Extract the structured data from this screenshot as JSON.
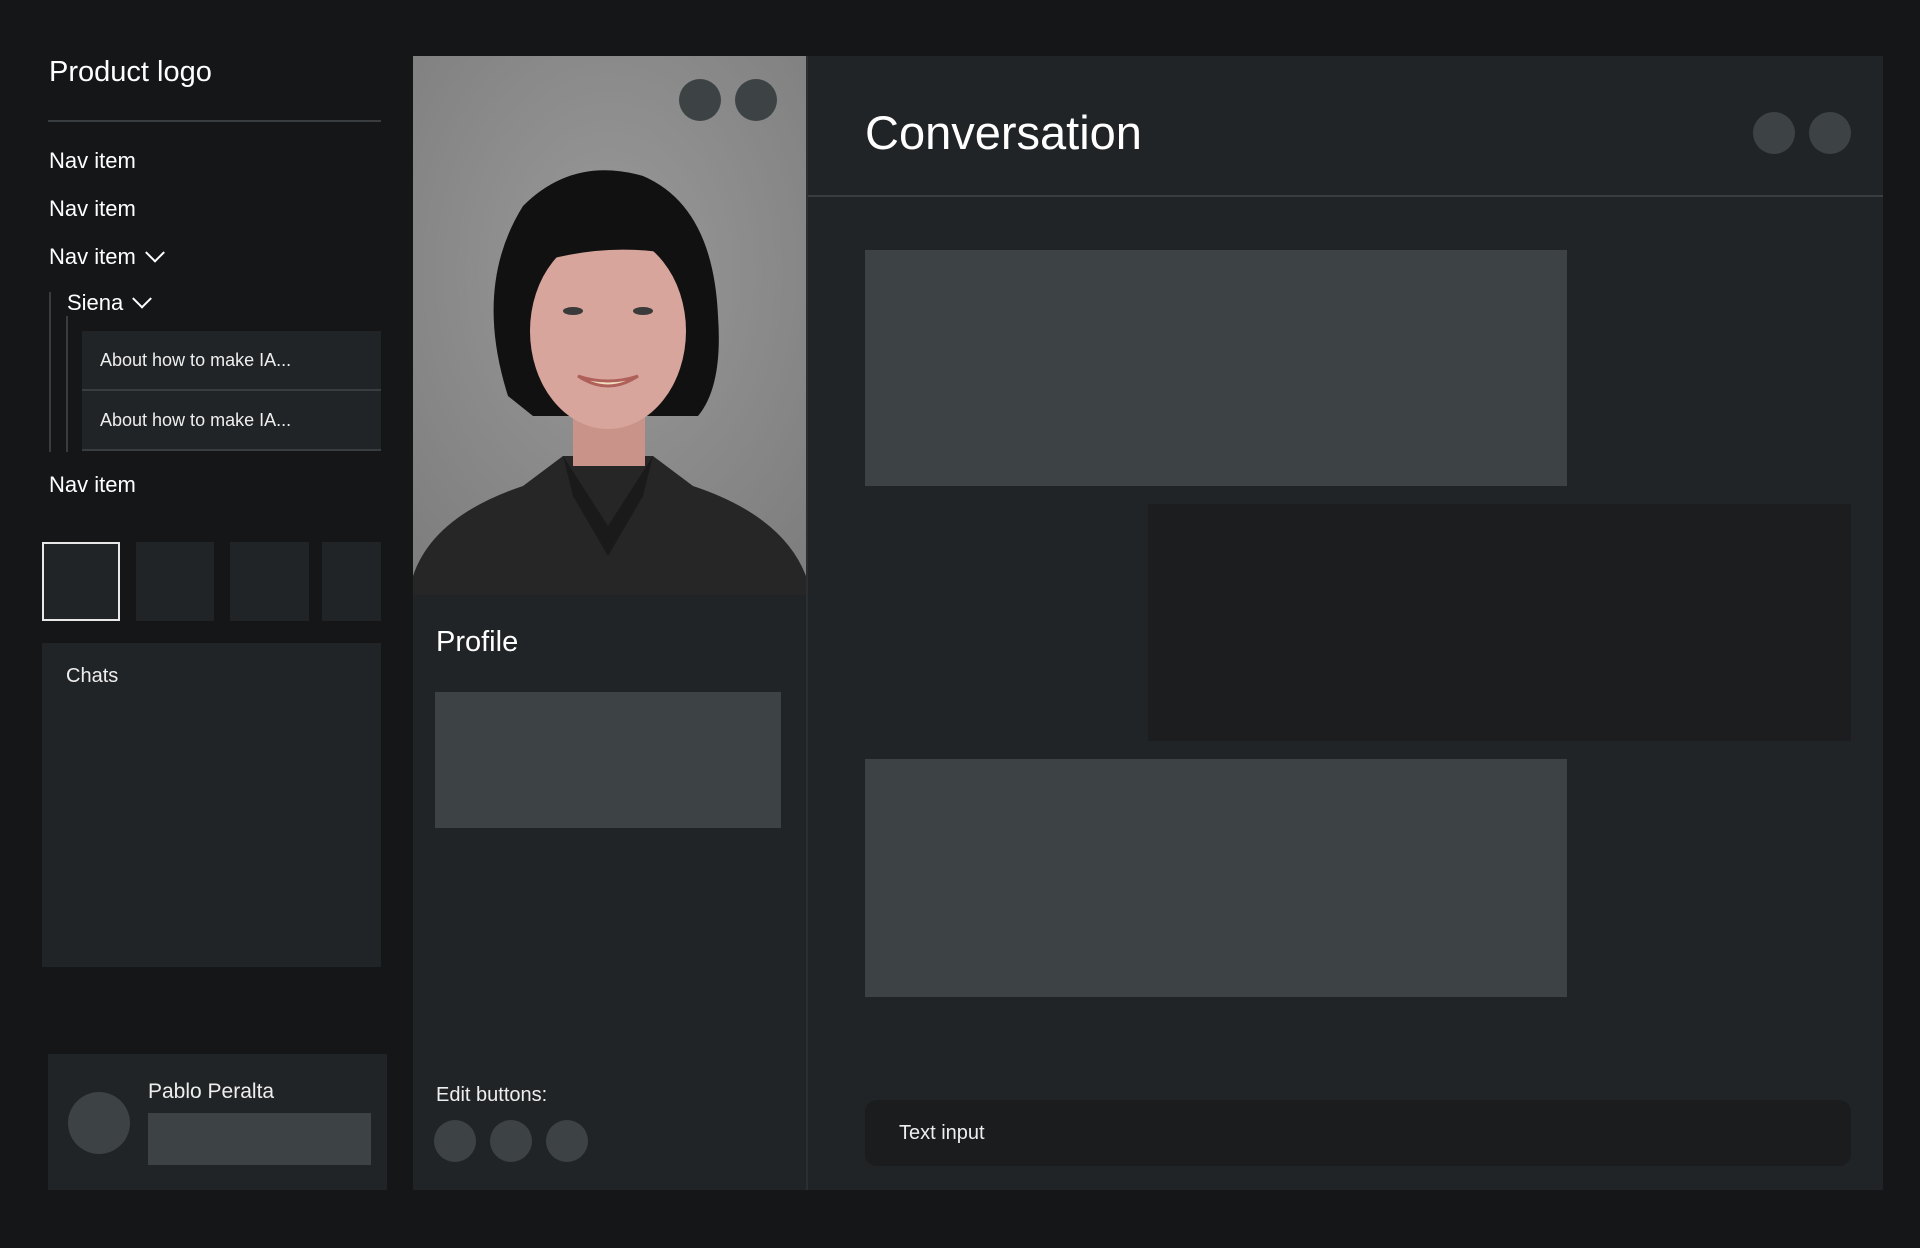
{
  "sidebar": {
    "logo": "Product logo",
    "nav": [
      {
        "label": "Nav item"
      },
      {
        "label": "Nav item"
      },
      {
        "label": "Nav item",
        "expanded": true
      },
      {
        "label": "Nav item"
      }
    ],
    "sub_group": {
      "label": "Siena",
      "items": [
        "About how to make IA...",
        "About how to make IA..."
      ]
    },
    "chats_label": "Chats",
    "user": {
      "name": "Pablo Peralta"
    }
  },
  "profile": {
    "heading": "Profile",
    "edit_label": "Edit buttons:"
  },
  "conversation": {
    "title": "Conversation",
    "input_placeholder": "Text input"
  },
  "colors": {
    "background": "#151618",
    "panel": "#212426",
    "placeholder": "#3d4245",
    "dark_bubble": "#1b1d1e"
  }
}
